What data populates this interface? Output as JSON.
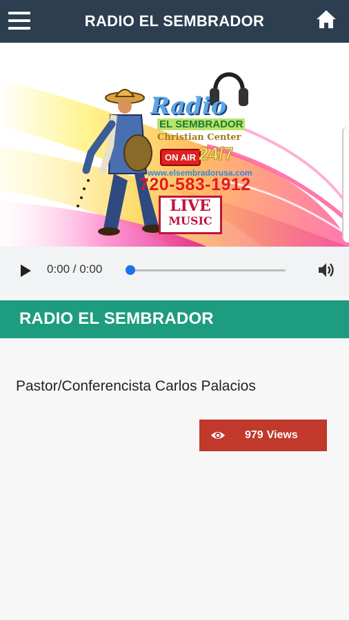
{
  "header": {
    "title": "RADIO EL SEMBRADOR",
    "menu_icon": "hamburger-menu-icon",
    "home_icon": "home-icon"
  },
  "banner": {
    "logo_word": "Radio",
    "logo_name": "EL SEMBRADOR",
    "logo_sub": "Christian Center",
    "on_air": "ON AIR",
    "hours": "24/7",
    "website": "www.elsembradorusa.com",
    "phone": "720-583-1912",
    "live": "LIVE",
    "music": "MUSIC"
  },
  "player": {
    "time": "0:00 / 0:00",
    "progress": 0,
    "play_icon": "play-icon",
    "volume_icon": "volume-icon"
  },
  "section": {
    "title": "RADIO EL SEMBRADOR"
  },
  "content": {
    "description": "Pastor/Conferencista Carlos Palacios"
  },
  "views": {
    "count": "979",
    "label": "Views",
    "icon": "eye-icon"
  },
  "colors": {
    "topbar": "#2c3e50",
    "section": "#1e9c80",
    "views_button": "#c0392b",
    "seek": "#1a73e8"
  }
}
